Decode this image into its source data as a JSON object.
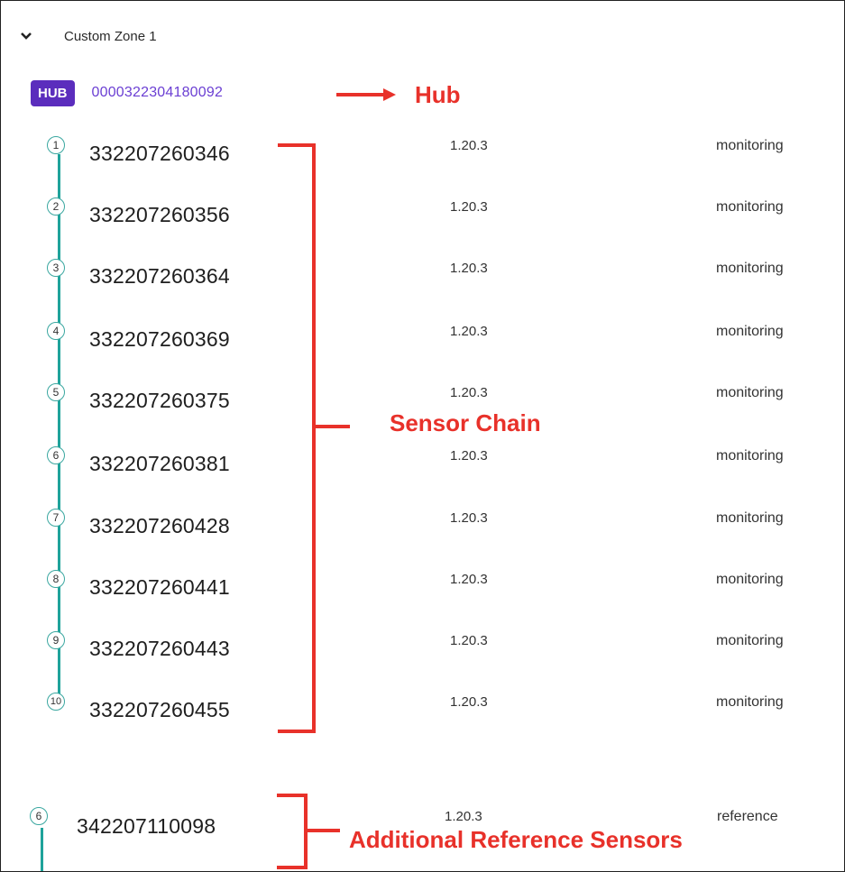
{
  "zone": {
    "title": "Custom Zone 1"
  },
  "hub": {
    "badge": "HUB",
    "id": "0000322304180092"
  },
  "columns": {
    "version": "1.20.3"
  },
  "sensors": [
    {
      "n": "1",
      "id": "332207260346",
      "version": "1.20.3",
      "status": "monitoring"
    },
    {
      "n": "2",
      "id": "332207260356",
      "version": "1.20.3",
      "status": "monitoring"
    },
    {
      "n": "3",
      "id": "332207260364",
      "version": "1.20.3",
      "status": "monitoring"
    },
    {
      "n": "4",
      "id": "332207260369",
      "version": "1.20.3",
      "status": "monitoring"
    },
    {
      "n": "5",
      "id": "332207260375",
      "version": "1.20.3",
      "status": "monitoring"
    },
    {
      "n": "6",
      "id": "332207260381",
      "version": "1.20.3",
      "status": "monitoring"
    },
    {
      "n": "7",
      "id": "332207260428",
      "version": "1.20.3",
      "status": "monitoring"
    },
    {
      "n": "8",
      "id": "332207260441",
      "version": "1.20.3",
      "status": "monitoring"
    },
    {
      "n": "9",
      "id": "332207260443",
      "version": "1.20.3",
      "status": "monitoring"
    },
    {
      "n": "10",
      "id": "332207260455",
      "version": "1.20.3",
      "status": "monitoring"
    }
  ],
  "reference": {
    "n": "6",
    "id": "342207110098",
    "version": "1.20.3",
    "status": "reference"
  },
  "annotations": {
    "hub": "Hub",
    "chain": "Sensor Chain",
    "reference": "Additional Reference Sensors"
  },
  "colors": {
    "annotation": "#e8312a",
    "hub_badge": "#5b2dbd",
    "chain_line": "#1fa39b"
  }
}
